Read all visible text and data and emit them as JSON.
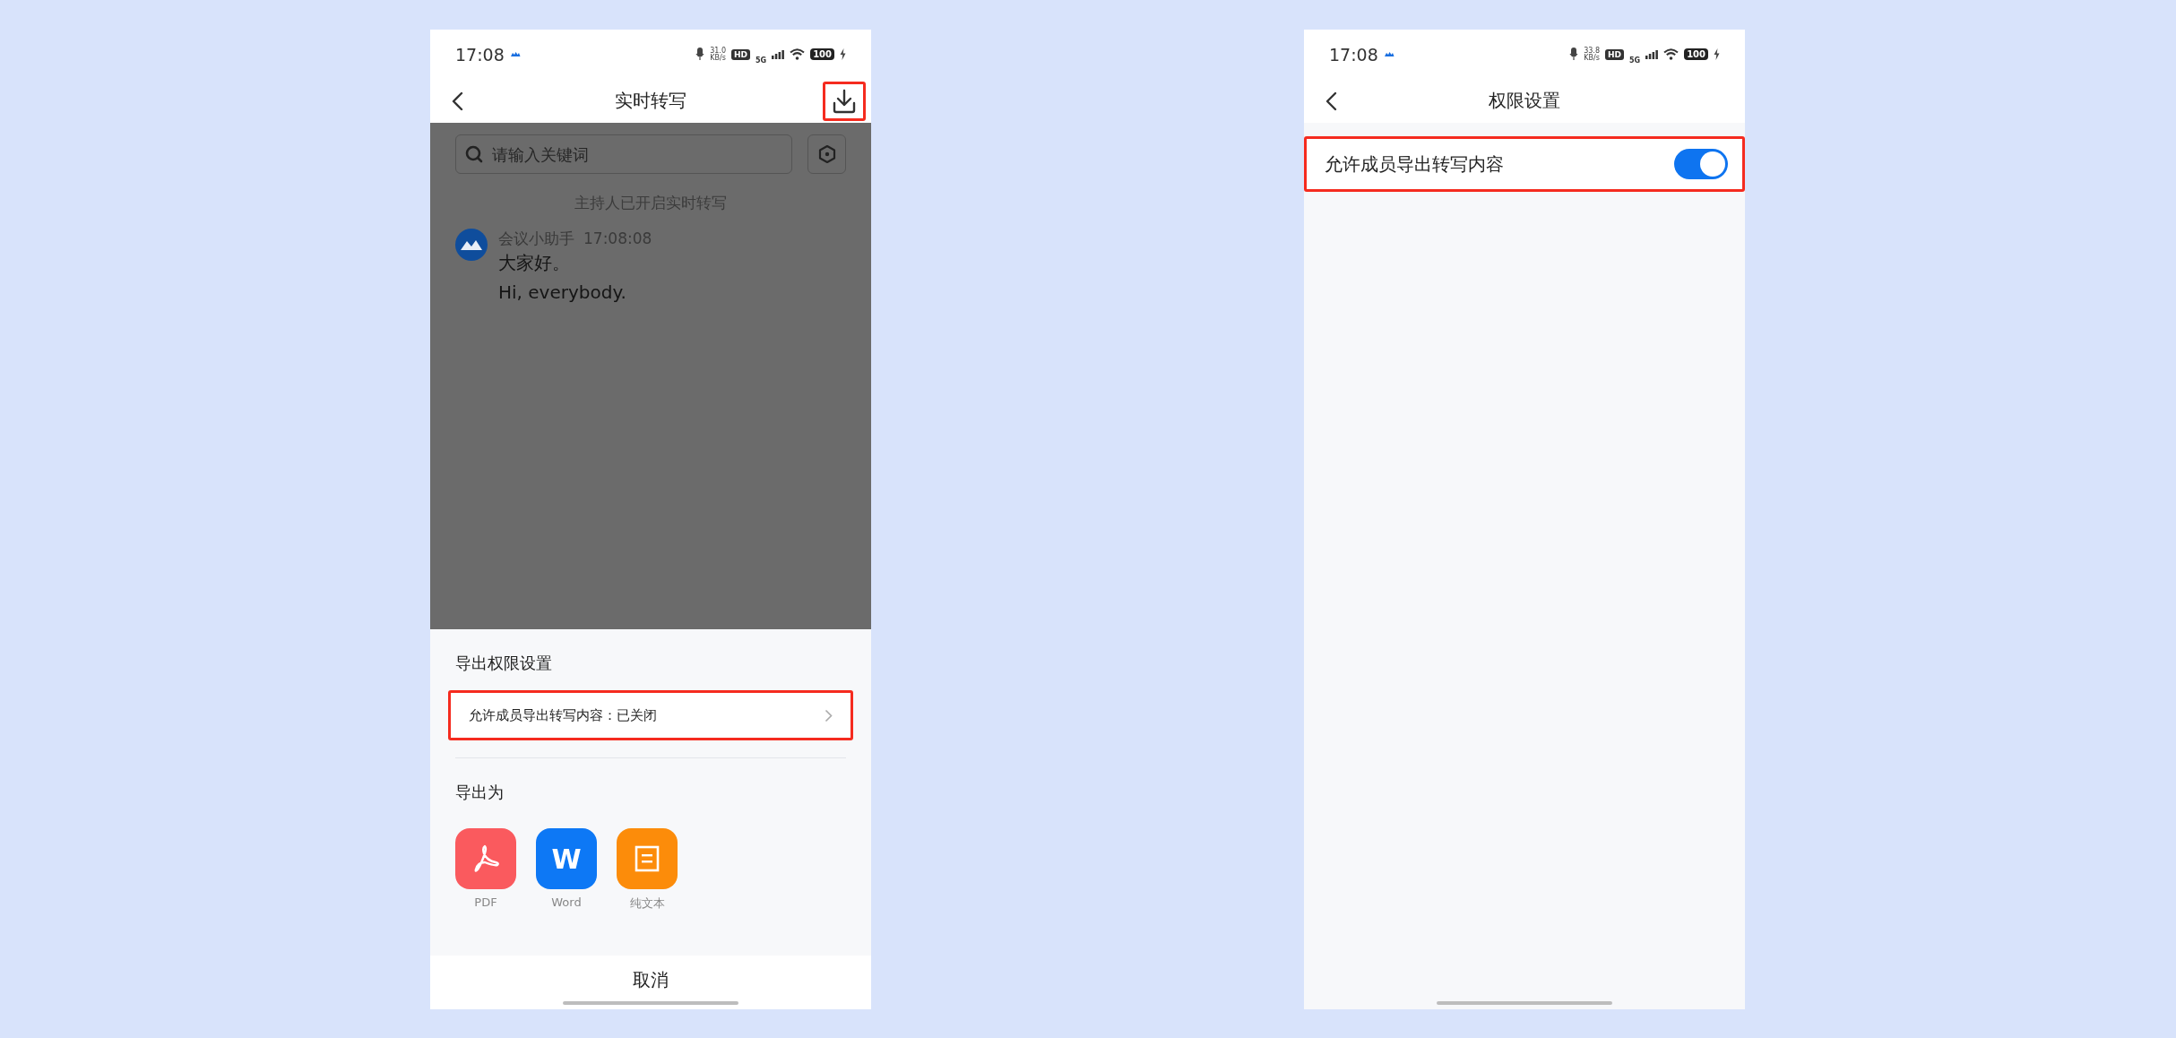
{
  "transcript_screen": {
    "status_bar": {
      "time": "17:08",
      "speed": "31.0",
      "speed_unit": "KB/s",
      "hd": "HD",
      "network": "5G",
      "battery": "100"
    },
    "nav": {
      "title": "实时转写",
      "download_highlighted": true
    },
    "search": {
      "placeholder": "请输入关键词"
    },
    "notice": "主持人已开启实时转写",
    "messages": [
      {
        "sender": "会议小助手",
        "time": "17:08:08",
        "lines": [
          "大家好。",
          "Hi, everybody."
        ]
      }
    ],
    "sheet": {
      "title": "导出权限设置",
      "permission_row": {
        "label": "允许成员导出转写内容：已关闭",
        "highlighted": true
      },
      "export_title": "导出为",
      "export_options": [
        {
          "kind": "pdf",
          "label": "PDF"
        },
        {
          "kind": "word",
          "glyph": "W",
          "label": "Word"
        },
        {
          "kind": "text",
          "label": "纯文本"
        }
      ],
      "cancel": "取消"
    }
  },
  "settings_screen": {
    "status_bar": {
      "time": "17:08",
      "speed": "33.8",
      "speed_unit": "KB/s",
      "hd": "HD",
      "network": "5G",
      "battery": "100"
    },
    "nav": {
      "title": "权限设置"
    },
    "settings": [
      {
        "label": "允许成员导出转写内容",
        "on": true,
        "highlighted": true
      }
    ]
  }
}
